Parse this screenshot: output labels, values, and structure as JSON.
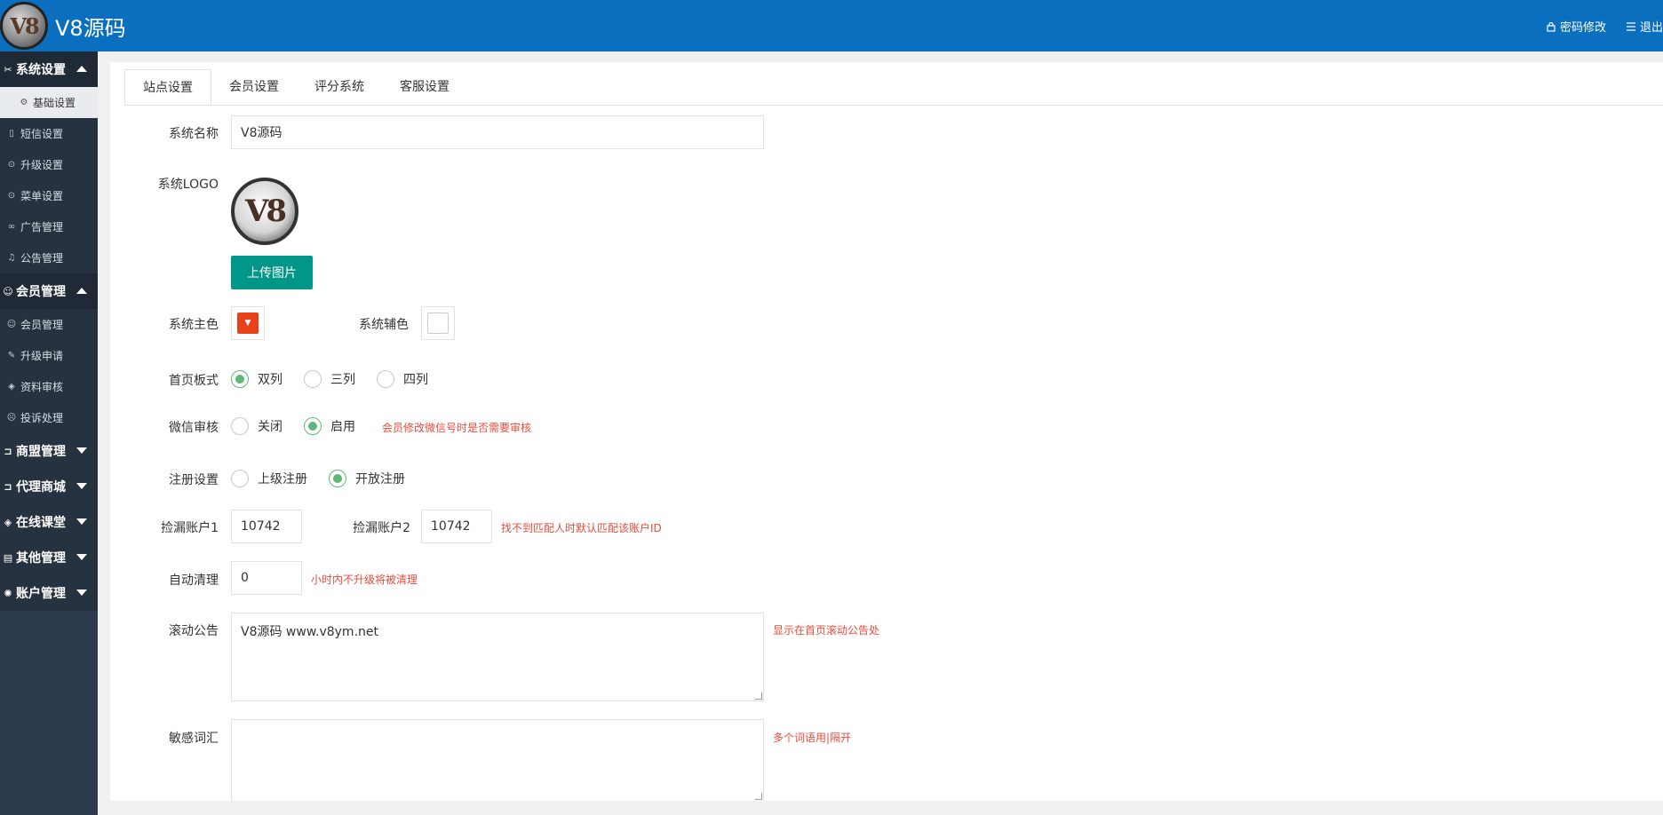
{
  "header": {
    "logo_text": "V8",
    "title": "V8源码",
    "links": [
      {
        "label": "密码修改",
        "icon": "lock-icon"
      },
      {
        "label": "退出",
        "icon": "menu-icon"
      }
    ],
    "bg_color": "#0b6fc0"
  },
  "sidebar": {
    "groups": [
      {
        "label": "系统设置",
        "icon": "tools-icon",
        "open": true,
        "items": [
          {
            "label": "基础设置",
            "icon": "gear-icon",
            "active": true
          },
          {
            "label": "短信设置",
            "icon": "phone-icon"
          },
          {
            "label": "升级设置",
            "icon": "upgrade-icon"
          },
          {
            "label": "菜单设置",
            "icon": "upgrade-icon"
          },
          {
            "label": "广告管理",
            "icon": "link-icon"
          },
          {
            "label": "公告管理",
            "icon": "bell-icon"
          }
        ]
      },
      {
        "label": "会员管理",
        "icon": "users-icon",
        "open": true,
        "items": [
          {
            "label": "会员管理",
            "icon": "user-icon"
          },
          {
            "label": "升级申请",
            "icon": "edit-icon"
          },
          {
            "label": "资料审核",
            "icon": "shield-icon"
          },
          {
            "label": "投诉处理",
            "icon": "face-icon"
          }
        ]
      },
      {
        "label": "商盟管理",
        "icon": "cart-icon",
        "open": false
      },
      {
        "label": "代理商城",
        "icon": "cart-icon",
        "open": false
      },
      {
        "label": "在线课堂",
        "icon": "cube-icon",
        "open": false
      },
      {
        "label": "其他管理",
        "icon": "doc-icon",
        "open": false
      },
      {
        "label": "账户管理",
        "icon": "gear-icon",
        "open": false
      }
    ]
  },
  "tabs": [
    {
      "label": "站点设置",
      "active": true
    },
    {
      "label": "会员设置"
    },
    {
      "label": "评分系统"
    },
    {
      "label": "客服设置"
    }
  ],
  "form": {
    "system_name": {
      "label": "系统名称",
      "value": "V8源码"
    },
    "system_logo": {
      "label": "系统LOGO",
      "logo_text": "V8",
      "upload_label": "上传图片"
    },
    "primary_color": {
      "label": "系统主色",
      "value": "#e8411a"
    },
    "secondary_color": {
      "label": "系统辅色",
      "value": "#ffffff"
    },
    "home_layout": {
      "label": "首页板式",
      "options": [
        "双列",
        "三列",
        "四列"
      ],
      "selected": "双列"
    },
    "wechat_review": {
      "label": "微信审核",
      "options": [
        "关闭",
        "启用"
      ],
      "selected": "启用",
      "hint": "会员修改微信号时是否需要审核"
    },
    "register": {
      "label": "注册设置",
      "options": [
        "上级注册",
        "开放注册"
      ],
      "selected": "开放注册"
    },
    "leak_account1": {
      "label": "捡漏账户1",
      "value": "10742"
    },
    "leak_account2": {
      "label": "捡漏账户2",
      "value": "10742",
      "hint": "找不到匹配人时默认匹配该账户ID"
    },
    "auto_clean": {
      "label": "自动清理",
      "value": "0",
      "hint": "小时内不升级将被清理"
    },
    "scroll_notice": {
      "label": "滚动公告",
      "value": "V8源码 www.v8ym.net",
      "hint": "显示在首页滚动公告处"
    },
    "sensitive_words": {
      "label": "敏感词汇",
      "value": "",
      "hint": "多个词语用|隔开"
    }
  }
}
